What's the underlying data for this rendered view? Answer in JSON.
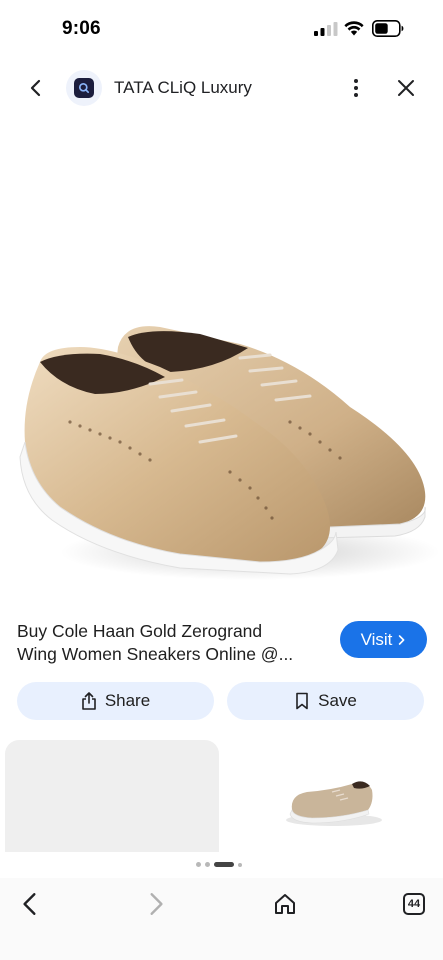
{
  "status_bar": {
    "time": "9:06"
  },
  "header": {
    "site_name": "TATA CLiQ Luxury"
  },
  "product": {
    "title_line1": "Buy Cole Haan Gold Zerogrand",
    "title_line2": "Wing Women Sneakers Online @...",
    "visit_label": "Visit",
    "share_label": "Share",
    "save_label": "Save"
  },
  "carousel": {
    "dot_count": 4,
    "active_index": 2
  },
  "toolbar": {
    "tab_count": "44"
  },
  "colors": {
    "accent": "#1a73e8",
    "chip_bg": "#e8f0fe",
    "shoe_gold": "#d9bd97"
  }
}
